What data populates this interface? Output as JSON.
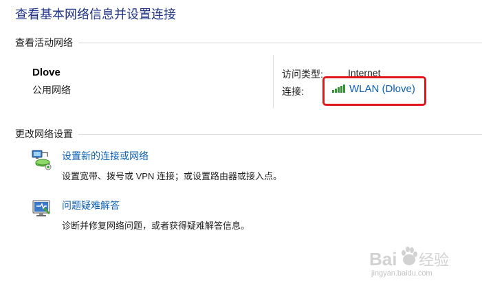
{
  "page": {
    "title": "查看基本网络信息并设置连接"
  },
  "active_networks": {
    "section_title": "查看活动网络",
    "network": {
      "name": "Dlove",
      "category": "公用网络",
      "access_type_label": "访问类型:",
      "access_type_value": "Internet",
      "connection_label": "连接:",
      "connection_value": "WLAN (Dlove)",
      "connection_icon": "wifi-signal-icon"
    },
    "highlight_color": "#e0161b"
  },
  "change_settings": {
    "section_title": "更改网络设置",
    "tasks": [
      {
        "icon": "network-setup-icon",
        "link": "设置新的连接或网络",
        "description": "设置宽带、拨号或 VPN 连接；或设置路由器或接入点。"
      },
      {
        "icon": "troubleshoot-icon",
        "link": "问题疑难解答",
        "description": "诊断并修复网络问题，或者获得疑难解答信息。"
      }
    ]
  },
  "watermark": {
    "logo_text": "Baidu经验",
    "site": "jingyan.baidu.com"
  },
  "colors": {
    "title": "#1e3287",
    "link": "#0a5fb4",
    "signal": "#2e9a2e"
  }
}
